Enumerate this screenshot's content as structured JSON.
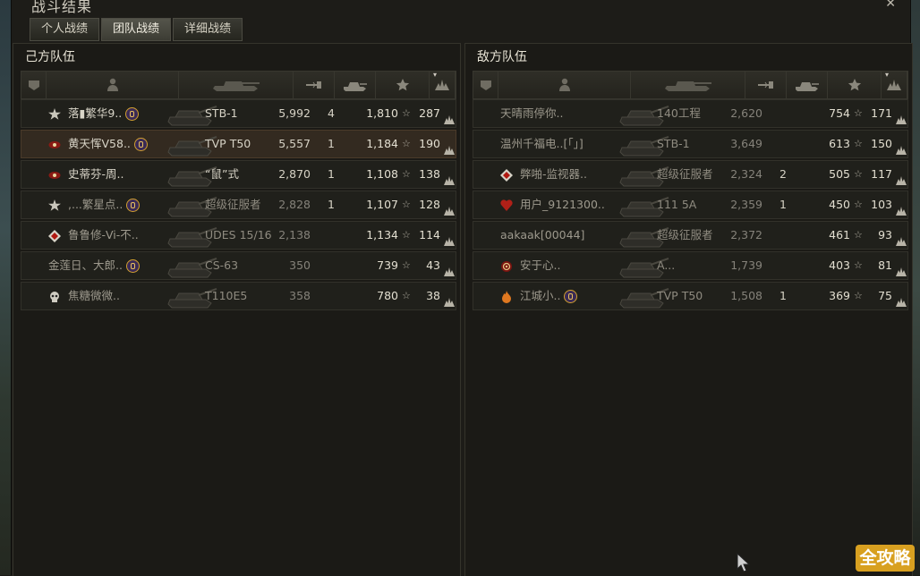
{
  "window": {
    "title": "战斗结果",
    "close": "✕"
  },
  "tabs": [
    {
      "label": "个人战绩",
      "active": false
    },
    {
      "label": "团队战绩",
      "active": true
    },
    {
      "label": "详细战绩",
      "active": false
    }
  ],
  "teams": [
    {
      "title": "己方队伍",
      "columns": [
        "platoon",
        "player",
        "vehicle",
        "damage",
        "kills",
        "experience",
        "points"
      ],
      "rows": [
        {
          "name": "落▮繁华9..",
          "mod": true,
          "vehicle": "STB-1",
          "damage": "5,992",
          "kills": "4",
          "xp": "1,810",
          "points": "287",
          "dim": false,
          "highlight": false,
          "badge": "star-badge"
        },
        {
          "name": "黄天恽V58..",
          "mod": true,
          "vehicle": "TVP T50",
          "damage": "5,557",
          "kills": "1",
          "xp": "1,184",
          "points": "190",
          "dim": false,
          "highlight": true,
          "badge": "eye-badge"
        },
        {
          "name": "史蒂芬-周..",
          "mod": false,
          "vehicle": "“鼠”式",
          "damage": "2,870",
          "kills": "1",
          "xp": "1,108",
          "points": "138",
          "dim": false,
          "highlight": false,
          "badge": "eye-badge"
        },
        {
          "name": ",...繁星点..",
          "mod": true,
          "vehicle": "超级征服者",
          "damage": "2,828",
          "kills": "1",
          "xp": "1,107",
          "points": "128",
          "dim": true,
          "highlight": false,
          "badge": "star-badge"
        },
        {
          "name": "鲁鲁修-Vi-不..",
          "mod": false,
          "vehicle": "UDES 15/16",
          "damage": "2,138",
          "kills": "",
          "xp": "1,134",
          "points": "114",
          "dim": true,
          "highlight": false,
          "badge": "diamond-badge"
        },
        {
          "name": "金莲日、大郎..",
          "mod": true,
          "vehicle": "CS-63",
          "damage": "350",
          "kills": "",
          "xp": "739",
          "points": "43",
          "dim": true,
          "highlight": false,
          "badge": ""
        },
        {
          "name": "焦糖微微..",
          "mod": false,
          "vehicle": "T110E5",
          "damage": "358",
          "kills": "",
          "xp": "780",
          "points": "38",
          "dim": true,
          "highlight": false,
          "badge": "skull-badge"
        }
      ]
    },
    {
      "title": "敌方队伍",
      "columns": [
        "platoon",
        "player",
        "vehicle",
        "damage",
        "kills",
        "experience",
        "points"
      ],
      "rows": [
        {
          "name": "天晴雨停你..",
          "mod": false,
          "vehicle": "140工程",
          "damage": "2,620",
          "kills": "",
          "xp": "754",
          "points": "171",
          "dim": true,
          "highlight": false,
          "badge": ""
        },
        {
          "name": "温州千福电..[「」]",
          "mod": false,
          "vehicle": "STB-1",
          "damage": "3,649",
          "kills": "",
          "xp": "613",
          "points": "150",
          "dim": true,
          "highlight": false,
          "badge": ""
        },
        {
          "name": "弊啪-监视器..",
          "mod": false,
          "vehicle": "超级征服者",
          "damage": "2,324",
          "kills": "2",
          "xp": "505",
          "points": "117",
          "dim": true,
          "highlight": false,
          "badge": "diamond-badge"
        },
        {
          "name": "用户_9121300..",
          "mod": false,
          "vehicle": "111 5A",
          "damage": "2,359",
          "kills": "1",
          "xp": "450",
          "points": "103",
          "dim": true,
          "highlight": false,
          "badge": "heart-badge"
        },
        {
          "name": "aakaak[00044]",
          "mod": false,
          "vehicle": "超级征服者",
          "damage": "2,372",
          "kills": "",
          "xp": "461",
          "points": "93",
          "dim": true,
          "highlight": false,
          "badge": ""
        },
        {
          "name": "安于心..",
          "mod": false,
          "vehicle": "A...",
          "damage": "1,739",
          "kills": "",
          "xp": "403",
          "points": "81",
          "dim": true,
          "highlight": false,
          "badge": "target-badge"
        },
        {
          "name": "江城小..",
          "mod": true,
          "vehicle": "TVP T50",
          "damage": "1,508",
          "kills": "1",
          "xp": "369",
          "points": "75",
          "dim": true,
          "highlight": false,
          "badge": "flame-badge"
        }
      ]
    }
  ],
  "star_glyph": "☆",
  "watermark": "全攻略"
}
